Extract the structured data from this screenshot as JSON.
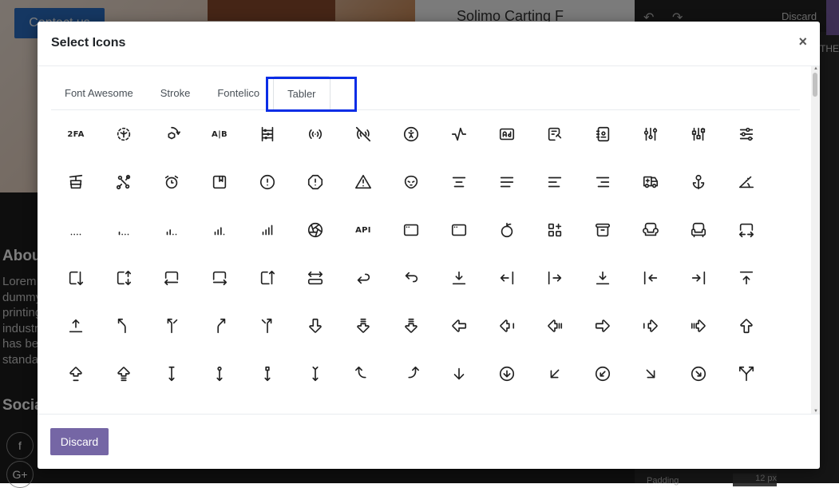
{
  "background": {
    "contact_button": "Contact us",
    "product_title": "Solimo Carting F",
    "about_heading": "About",
    "about_lines": [
      "Lorem",
      "dummy",
      "printing",
      "industry",
      "has been",
      "standard"
    ],
    "social_heading": "Social",
    "social_icons": [
      "f",
      "G+"
    ],
    "editor": {
      "discard": "Discard",
      "theme_tab": "THEME",
      "padding_label": "Padding",
      "padding_value": "12 px"
    }
  },
  "modal": {
    "title": "Select Icons",
    "close": "×",
    "tabs": [
      "Font Awesome",
      "Stroke",
      "Fontelico",
      "Tabler"
    ],
    "active_tab": "Tabler",
    "discard_label": "Discard"
  },
  "icons": [
    "2fa",
    "3d-cube-sphere",
    "3d-rotate",
    "a-b",
    "abacus",
    "access-point",
    "access-point-off",
    "accessible",
    "activity",
    "ad",
    "ad-2",
    "address-book",
    "adjustments",
    "adjustments-alt",
    "adjustments-horizontal",
    "aerial-lift",
    "affiliate",
    "alarm",
    "album",
    "alert-circle",
    "alert-octagon",
    "alert-triangle",
    "alien",
    "align-center",
    "align-justified",
    "align-left",
    "align-right",
    "ambulance",
    "anchor",
    "angle",
    "antenna-bars-1",
    "antenna-bars-2",
    "antenna-bars-3",
    "antenna-bars-4",
    "antenna-bars-5",
    "aperture",
    "api",
    "app-window-alt",
    "app-window",
    "apple",
    "apps",
    "archive",
    "armchair-2",
    "armchair",
    "arrow-autofit-width",
    "arrow-autofit-down",
    "arrow-autofit-height",
    "arrow-autofit-left",
    "arrow-autofit-right",
    "arrow-autofit-up",
    "arrow-autofit-content",
    "arrow-back",
    "arrow-back-up",
    "arrow-bar-down",
    "arrow-bar-left",
    "arrow-bar-right",
    "arrow-bar-to-down",
    "arrow-bar-to-left",
    "arrow-bar-to-right",
    "arrow-bar-to-up",
    "arrow-bar-up",
    "arrow-bear-left",
    "arrow-bear-left-2",
    "arrow-bear-right",
    "arrow-bear-right-2",
    "arrow-big-down",
    "arrow-big-down-line",
    "arrow-big-down-lines",
    "arrow-big-left",
    "arrow-big-left-line",
    "arrow-big-left-lines",
    "arrow-big-right",
    "arrow-big-right-line",
    "arrow-big-right-lines",
    "arrow-big-top",
    "arrow-big-up-line",
    "arrow-big-up-lines",
    "arrow-bottom-bar",
    "arrow-bottom-circle",
    "arrow-bottom-square",
    "arrow-bottom-tail",
    "arrow-curve-left",
    "arrow-curve-right",
    "arrow-down",
    "arrow-down-circle",
    "arrow-down-left",
    "arrow-down-left-circle",
    "arrow-down-right",
    "arrow-down-right-circle",
    "arrow-fork"
  ],
  "text_glyphs": {
    "2fa": "2FA",
    "api": "API",
    "a-b": "A|B"
  }
}
